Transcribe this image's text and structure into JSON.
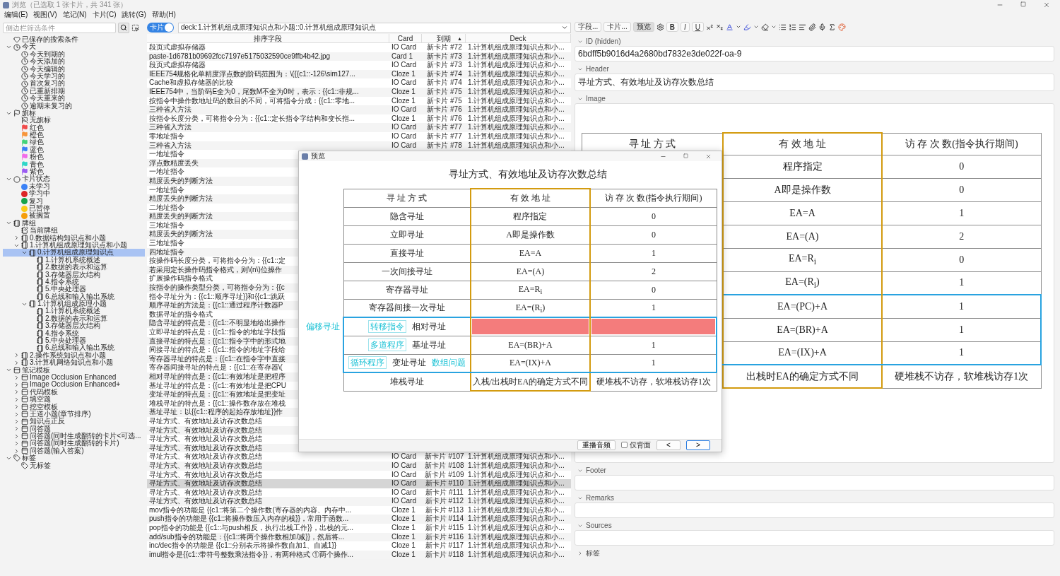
{
  "window": {
    "title": "浏览（已选取 1 张卡片，共 341 张）"
  },
  "menu": [
    "编辑(E)",
    "视图(V)",
    "笔记(N)",
    "卡片(C)",
    "跳转(G)",
    "帮助(H)"
  ],
  "sidebar": {
    "search": {
      "placeholder": "侧边栏筛选条件"
    },
    "items": [
      {
        "label": "已保存的搜索条件",
        "kind": "saved-search",
        "selected": false
      },
      {
        "label": "今天",
        "kind": "today",
        "expanded": true,
        "selected": false,
        "children": [
          {
            "label": "今天到期的",
            "kind": "clock",
            "selected": false
          },
          {
            "label": "今天添加的",
            "kind": "clock",
            "selected": false
          },
          {
            "label": "今天编辑的",
            "kind": "clock",
            "selected": false
          },
          {
            "label": "今天学习的",
            "kind": "clock",
            "selected": false
          },
          {
            "label": "首次复习的",
            "kind": "clock",
            "selected": false
          },
          {
            "label": "已重新排期",
            "kind": "clock",
            "selected": false
          },
          {
            "label": "今天重来的",
            "kind": "clock",
            "selected": false
          },
          {
            "label": "逾期未复习的",
            "kind": "clock",
            "selected": false
          }
        ]
      },
      {
        "label": "旗标",
        "kind": "flags",
        "expanded": true,
        "selected": false,
        "children": [
          {
            "label": "无旗标",
            "kind": "no-flag",
            "selected": false
          },
          {
            "label": "红色",
            "kind": "flag",
            "color": "#f14b4b",
            "selected": false
          },
          {
            "label": "橙色",
            "kind": "flag",
            "color": "#f7953b",
            "selected": false
          },
          {
            "label": "绿色",
            "kind": "flag",
            "color": "#44d37a",
            "selected": false
          },
          {
            "label": "蓝色",
            "kind": "flag",
            "color": "#3b7ff5",
            "selected": false
          },
          {
            "label": "粉色",
            "kind": "flag",
            "color": "#f26bea",
            "selected": false
          },
          {
            "label": "青色",
            "kind": "flag",
            "color": "#2fd6c9",
            "selected": false
          },
          {
            "label": "紫色",
            "kind": "flag",
            "color": "#9b5cf2",
            "selected": false
          }
        ]
      },
      {
        "label": "卡片状态",
        "kind": "card-state",
        "expanded": true,
        "selected": false,
        "children": [
          {
            "label": "未学习",
            "kind": "state",
            "color": "#3b82f6",
            "selected": false
          },
          {
            "label": "学习中",
            "kind": "state",
            "color": "#dc2626",
            "selected": false
          },
          {
            "label": "复习",
            "kind": "state",
            "color": "#16a34a",
            "selected": false
          },
          {
            "label": "已暂停",
            "kind": "state",
            "color": "#facc15",
            "selected": false
          },
          {
            "label": "被搁置",
            "kind": "state",
            "color": "#f59e0b",
            "selected": false
          }
        ]
      },
      {
        "label": "牌组",
        "kind": "decks",
        "expanded": true,
        "selected": false,
        "children": [
          {
            "label": "当前牌组",
            "kind": "current-deck",
            "selected": false
          },
          {
            "label": "0.数据结构知识点和小题",
            "kind": "deck",
            "expanded": false,
            "selected": false
          },
          {
            "label": "1.计算机组成原理知识点和小题",
            "kind": "deck",
            "expanded": true,
            "selected": false,
            "children": [
              {
                "label": "0.计算机组成原理知识点",
                "kind": "deck",
                "expanded": true,
                "selected": true,
                "children": [
                  {
                    "label": "1.计算机系统概述",
                    "kind": "deck",
                    "selected": false
                  },
                  {
                    "label": "2.数据的表示和运算",
                    "kind": "deck",
                    "selected": false
                  },
                  {
                    "label": "3.存储器层次结构",
                    "kind": "deck",
                    "selected": false
                  },
                  {
                    "label": "4.指令系统",
                    "kind": "deck",
                    "selected": false
                  },
                  {
                    "label": "5.中央处理器",
                    "kind": "deck",
                    "selected": false
                  },
                  {
                    "label": "6.总线和输入输出系统",
                    "kind": "deck",
                    "selected": false
                  }
                ]
              },
              {
                "label": "1.计算机组成原理小题",
                "kind": "deck",
                "expanded": true,
                "selected": false,
                "children": [
                  {
                    "label": "1.计算机系统概述",
                    "kind": "deck",
                    "selected": false
                  },
                  {
                    "label": "2.数据的表示和运算",
                    "kind": "deck",
                    "selected": false
                  },
                  {
                    "label": "3.存储器层次结构",
                    "kind": "deck",
                    "selected": false
                  },
                  {
                    "label": "4.指令系统",
                    "kind": "deck",
                    "selected": false
                  },
                  {
                    "label": "5.中央处理器",
                    "kind": "deck",
                    "selected": false
                  },
                  {
                    "label": "6.总线和输入输出系统",
                    "kind": "deck",
                    "selected": false
                  }
                ]
              }
            ]
          },
          {
            "label": "2.操作系统知识点和小题",
            "kind": "deck",
            "expanded": false,
            "selected": false
          },
          {
            "label": "3.计算机网络知识点和小题",
            "kind": "deck",
            "expanded": false,
            "selected": false
          }
        ]
      },
      {
        "label": "笔记模板",
        "kind": "notetypes",
        "expanded": true,
        "selected": false,
        "children": [
          {
            "label": "Image Occlusion Enhanced",
            "kind": "notetype",
            "expanded": false,
            "selected": false
          },
          {
            "label": "Image Occlusion Enhanced+",
            "kind": "notetype",
            "expanded": false,
            "selected": false
          },
          {
            "label": "代码模板",
            "kind": "notetype",
            "expanded": false,
            "selected": false
          },
          {
            "label": "填空题",
            "kind": "notetype",
            "expanded": false,
            "selected": false
          },
          {
            "label": "挖空模板",
            "kind": "notetype",
            "expanded": false,
            "selected": false
          },
          {
            "label": "王道小题(章节排序)",
            "kind": "notetype",
            "expanded": false,
            "selected": false
          },
          {
            "label": "知识点正反",
            "kind": "notetype",
            "expanded": false,
            "selected": false
          },
          {
            "label": "问答题",
            "kind": "notetype",
            "expanded": false,
            "selected": false
          },
          {
            "label": "问答题(同时生成翻转的卡片<可选...",
            "kind": "notetype",
            "expanded": false,
            "selected": false
          },
          {
            "label": "问答题(同时生成翻转的卡片)",
            "kind": "notetype",
            "expanded": false,
            "selected": false
          },
          {
            "label": "问答题(输入答案)",
            "kind": "notetype",
            "expanded": false,
            "selected": false
          }
        ]
      },
      {
        "label": "标签",
        "kind": "tags",
        "expanded": true,
        "selected": false,
        "children": [
          {
            "label": "无标签",
            "kind": "no-tag",
            "selected": false
          }
        ]
      }
    ]
  },
  "browser": {
    "mode_toggle": {
      "label": "卡片",
      "on": true
    },
    "search": {
      "value": "deck:1.计算机组成原理知识点和小题::0.计算机组成原理知识点"
    },
    "table": {
      "columns": [
        {
          "label": "排序字段"
        },
        {
          "label": "Card"
        },
        {
          "label": "到期",
          "sort": "▲"
        },
        {
          "label": "Deck"
        }
      ],
      "rows": [
        {
          "sort_field": "段页式虚拟存储器",
          "card": "IO Card",
          "due": "新卡片 #72",
          "deck": "1.计算机组成原理知识点和小...",
          "selected": false
        },
        {
          "sort_field": "paste-1d6781b09692fcc7197e5175032590ce9ffb4b42.jpg",
          "card": "Card 1",
          "due": "新卡片 #73",
          "deck": "1.计算机组成原理知识点和小...",
          "selected": false
        },
        {
          "sort_field": "段页式虚拟存储器",
          "card": "IO Card",
          "due": "新卡片 #73",
          "deck": "1.计算机组成原理知识点和小...",
          "selected": false
        },
        {
          "sort_field": "IEEE754规格化单精度浮点数的阶码范围为：\\({{c1::-126\\sim127...",
          "card": "Cloze 1",
          "due": "新卡片 #74",
          "deck": "1.计算机组成原理知识点和小...",
          "selected": false
        },
        {
          "sort_field": "Cache和虚拟存储器的比较",
          "card": "IO Card",
          "due": "新卡片 #74",
          "deck": "1.计算机组成原理知识点和小...",
          "selected": false
        },
        {
          "sort_field": "IEEE754中，当阶码E全为0，尾数M不全为0时，表示：{{c1::非规...",
          "card": "Cloze 1",
          "due": "新卡片 #75",
          "deck": "1.计算机组成原理知识点和小...",
          "selected": false
        },
        {
          "sort_field": "按指令中操作数地址码的数目的不同，可将指令分成：{{c1::零地...",
          "card": "Cloze 1",
          "due": "新卡片 #75",
          "deck": "1.计算机组成原理知识点和小...",
          "selected": false
        },
        {
          "sort_field": "三种省入方法",
          "card": "IO Card",
          "due": "新卡片 #76",
          "deck": "1.计算机组成原理知识点和小...",
          "selected": false
        },
        {
          "sort_field": "按指令长度分类，可将指令分为：{{c1::定长指令字结构和变长指...",
          "card": "Cloze 1",
          "due": "新卡片 #76",
          "deck": "1.计算机组成原理知识点和小...",
          "selected": false
        },
        {
          "sort_field": "三种省入方法",
          "card": "IO Card",
          "due": "新卡片 #77",
          "deck": "1.计算机组成原理知识点和小...",
          "selected": false
        },
        {
          "sort_field": "零地址指令",
          "card": "IO Card",
          "due": "新卡片 #77",
          "deck": "1.计算机组成原理知识点和小...",
          "selected": false
        },
        {
          "sort_field": "三种省入方法",
          "card": "IO Card",
          "due": "新卡片 #78",
          "deck": "1.计算机组成原理知识点和小...",
          "selected": false
        },
        {
          "sort_field": "一地址指令",
          "selected": false
        },
        {
          "sort_field": "浮点数精度丢失",
          "selected": false
        },
        {
          "sort_field": "一地址指令",
          "selected": false
        },
        {
          "sort_field": "精度丢失的判断方法",
          "selected": false
        },
        {
          "sort_field": "一地址指令",
          "selected": false
        },
        {
          "sort_field": "精度丢失的判断方法",
          "selected": false
        },
        {
          "sort_field": "二地址指令",
          "selected": false
        },
        {
          "sort_field": "精度丢失的判断方法",
          "selected": false
        },
        {
          "sort_field": "三地址指令",
          "selected": false
        },
        {
          "sort_field": "精度丢失的判断方法",
          "selected": false
        },
        {
          "sort_field": "三地址指令",
          "selected": false
        },
        {
          "sort_field": "四地址指令",
          "selected": false
        },
        {
          "sort_field": "按操作码长度分类，可将指令分为：{{c1::定",
          "selected": false
        },
        {
          "sort_field": "若采用定长操作码指令格式，则\\(n\\)位操作",
          "selected": false
        },
        {
          "sort_field": "扩展操作码指令格式",
          "selected": false
        },
        {
          "sort_field": "按指令的操作类型分类，可将指令分为：{{c",
          "selected": false
        },
        {
          "sort_field": "指令寻址分为：{{c1::顺序寻址}}和{{c1::跳跃",
          "selected": false
        },
        {
          "sort_field": "顺序寻址的方法是：{{c1::通过程序计数器P",
          "selected": false
        },
        {
          "sort_field": "数据寻址的指令格式",
          "selected": false
        },
        {
          "sort_field": "隐含寻址的特点是：{{c1::不明显地给出操作",
          "selected": false
        },
        {
          "sort_field": "立即寻址的特点是：{{c1::指令的地址字段指",
          "selected": false
        },
        {
          "sort_field": "直接寻址的特点是：{{c1::指令字中的形式地",
          "selected": false
        },
        {
          "sort_field": "间接寻址的特点是：{{c1::指令的地址字段给",
          "selected": false
        },
        {
          "sort_field": "寄存器寻址的特点是：{{c1::在指令字中直接",
          "selected": false
        },
        {
          "sort_field": "寄存器间接寻址的特点是：{{c1::在寄存器\\(",
          "selected": false
        },
        {
          "sort_field": "相对寻址的特点是：{{c1::有效地址是把程序",
          "selected": false
        },
        {
          "sort_field": "基址寻址的特点是：{{c1::有效地址是把CPU",
          "selected": false
        },
        {
          "sort_field": "变址寻址的特点是：{{c1::有效地址是把变址",
          "selected": false
        },
        {
          "sort_field": "堆栈寻址的特点是：{{c1::操作数存放在堆栈",
          "selected": false
        },
        {
          "sort_field": "基址寻址：以{{c1::程序的起始存放地址}}作",
          "selected": false
        },
        {
          "sort_field": "寻址方式、有效地址及访存次数总结",
          "selected": false
        },
        {
          "sort_field": "寻址方式、有效地址及访存次数总结",
          "selected": false
        },
        {
          "sort_field": "寻址方式、有效地址及访存次数总结",
          "selected": false
        },
        {
          "sort_field": "寻址方式、有效地址及访存次数总结",
          "selected": false
        },
        {
          "sort_field": "寻址方式、有效地址及访存次数总结",
          "card": "IO Card",
          "due": "新卡片 #107",
          "deck": "1.计算机组成原理知识点和小...",
          "selected": false
        },
        {
          "sort_field": "寻址方式、有效地址及访存次数总结",
          "card": "IO Card",
          "due": "新卡片 #108",
          "deck": "1.计算机组成原理知识点和小...",
          "selected": false
        },
        {
          "sort_field": "寻址方式、有效地址及访存次数总结",
          "card": "IO Card",
          "due": "新卡片 #109",
          "deck": "1.计算机组成原理知识点和小...",
          "selected": false
        },
        {
          "sort_field": "寻址方式、有效地址及访存次数总结",
          "card": "IO Card",
          "due": "新卡片 #110",
          "deck": "1.计算机组成原理知识点和小...",
          "selected": true
        },
        {
          "sort_field": "寻址方式、有效地址及访存次数总结",
          "card": "IO Card",
          "due": "新卡片 #111",
          "deck": "1.计算机组成原理知识点和小...",
          "selected": false
        },
        {
          "sort_field": "寻址方式、有效地址及访存次数总结",
          "card": "IO Card",
          "due": "新卡片 #112",
          "deck": "1.计算机组成原理知识点和小...",
          "selected": false
        },
        {
          "sort_field": "mov指令的功能是 {{c1::将第二个操作数(寄存器的内容、内存中...",
          "card": "Cloze 1",
          "due": "新卡片 #113",
          "deck": "1.计算机组成原理知识点和小...",
          "selected": false
        },
        {
          "sort_field": "push指令的功能是 {{c1::将操作数压入内存的栈}}，常用于函数...",
          "card": "Cloze 1",
          "due": "新卡片 #114",
          "deck": "1.计算机组成原理知识点和小...",
          "selected": false
        },
        {
          "sort_field": "pop指令的功能是 {{c1::与push相反，执行出栈工作}}，出栈的元...",
          "card": "Cloze 1",
          "due": "新卡片 #115",
          "deck": "1.计算机组成原理知识点和小...",
          "selected": false
        },
        {
          "sort_field": "add/sub指令的功能是：{{c1::将两个操作数相加/减}}，然后将...",
          "card": "Cloze 1",
          "due": "新卡片 #116",
          "deck": "1.计算机组成原理知识点和小...",
          "selected": false
        },
        {
          "sort_field": "inc/dec指令的功能是 {{c1::分别表示将操作数自加1、自减1}}",
          "card": "Cloze 1",
          "due": "新卡片 #117",
          "deck": "1.计算机组成原理知识点和小...",
          "selected": false
        },
        {
          "sort_field": "imul指令是{{c1::带符号整数乘法指令}}，有两种格式 ①两个操作...",
          "card": "Cloze 1",
          "due": "新卡片 #118",
          "deck": "1.计算机组成原理知识点和小...",
          "selected": false
        }
      ]
    }
  },
  "editor": {
    "toolbar": {
      "buttons": [
        {
          "label": "字段...",
          "selected": false
        },
        {
          "label": "卡片...",
          "selected": false
        },
        {
          "label": "预览",
          "selected": true
        }
      ],
      "format": [
        {
          "label": "B",
          "kind": "bold"
        },
        {
          "label": "I",
          "kind": "italic"
        },
        {
          "label": "U",
          "kind": "underline"
        }
      ]
    },
    "fields": [
      {
        "label": "ID (hidden)",
        "kind": "text",
        "value": "6bdff5b9016d4a2680bd7832e3de022f-oa-9"
      },
      {
        "label": "Header",
        "kind": "text",
        "value": "寻址方式、有效地址及访存次数总结"
      },
      {
        "label": "Image",
        "kind": "image",
        "columns": [
          {
            "label": "寻 址 方 式",
            "outlined": false
          },
          {
            "label": "有 效 地 址",
            "outlined": true
          },
          {
            "label": "访 存 次 数(指令执行期间)",
            "outlined": false
          }
        ],
        "rows": [
          {
            "address": "程序指定",
            "count": "0",
            "outlined": false
          },
          {
            "address": "A即是操作数",
            "count": "0",
            "outlined": false
          },
          {
            "address": "EA=A",
            "count": "1",
            "outlined": false
          },
          {
            "address": "EA=(A)",
            "count": "2",
            "outlined": false
          },
          {
            "address": "EA=R$_{i}$",
            "count": "0",
            "outlined": false
          },
          {
            "address": "EA=(R$_{i}$)",
            "count": "1",
            "outlined": false
          },
          {
            "address": "EA=(PC)+A",
            "count": "1",
            "outlined": true
          },
          {
            "address": "EA=(BR)+A",
            "count": "1",
            "outlined": true
          },
          {
            "address": "EA=(IX)+A",
            "count": "1",
            "outlined": true
          },
          {
            "address": "出栈时EA的确定方式不同",
            "count": "硬堆栈不访存，软堆栈访存1次",
            "outlined": false
          }
        ]
      },
      {
        "label": "Footer",
        "kind": "text"
      },
      {
        "label": "Remarks",
        "kind": "text"
      },
      {
        "label": "Sources",
        "kind": "text"
      }
    ],
    "tags": {
      "label": "标签"
    }
  },
  "preview": {
    "title": "预览",
    "heading": "寻址方式、有效地址及访存次数总结",
    "group_label": "偏移寻址",
    "columns": [
      {
        "label": "寻 址 方 式",
        "outlined": false
      },
      {
        "label": "有 效 地 址",
        "outlined": true
      },
      {
        "label": "访 存 次 数(指令执行期间)",
        "outlined": false
      }
    ],
    "rows": [
      {
        "method": "隐含寻址",
        "address": "程序指定",
        "count": "0",
        "masked": false,
        "outlined": false
      },
      {
        "method": "立即寻址",
        "address": "A即是操作数",
        "count": "0",
        "masked": false,
        "outlined": false
      },
      {
        "method": "直接寻址",
        "address": "EA=A",
        "count": "1",
        "masked": false,
        "outlined": false
      },
      {
        "method": "一次间接寻址",
        "address": "EA=(A)",
        "count": "2",
        "masked": false,
        "outlined": false
      },
      {
        "method": "寄存器寻址",
        "address": "EA=R$_{i}$",
        "count": "0",
        "masked": false,
        "outlined": false
      },
      {
        "method": "寄存器间接一次寻址",
        "address": "EA=(R$_{i}$)",
        "count": "1",
        "masked": false,
        "outlined": false
      },
      {
        "note": "转移指令",
        "method": "相对寻址",
        "masked": true,
        "outlined": true
      },
      {
        "note": "多道程序",
        "method": "基址寻址",
        "address": "EA=(BR)+A",
        "count": "1",
        "masked": false,
        "outlined": true
      },
      {
        "note": "循环程序",
        "method": "变址寻址",
        "note_after": "数组问题",
        "address": "EA=(IX)+A",
        "count": "1",
        "masked": false,
        "outlined": true
      },
      {
        "method": "堆栈寻址",
        "address": "入栈/出栈时EA的确定方式不同",
        "count": "硬堆栈不访存，软堆栈访存1次",
        "masked": false,
        "outlined": false
      }
    ],
    "controls": {
      "replay": "重播音频",
      "back_only": {
        "label": "仅背面",
        "checked": false
      },
      "prev": {
        "label": "<",
        "focused": false
      },
      "next": {
        "label": ">",
        "focused": true
      }
    }
  }
}
